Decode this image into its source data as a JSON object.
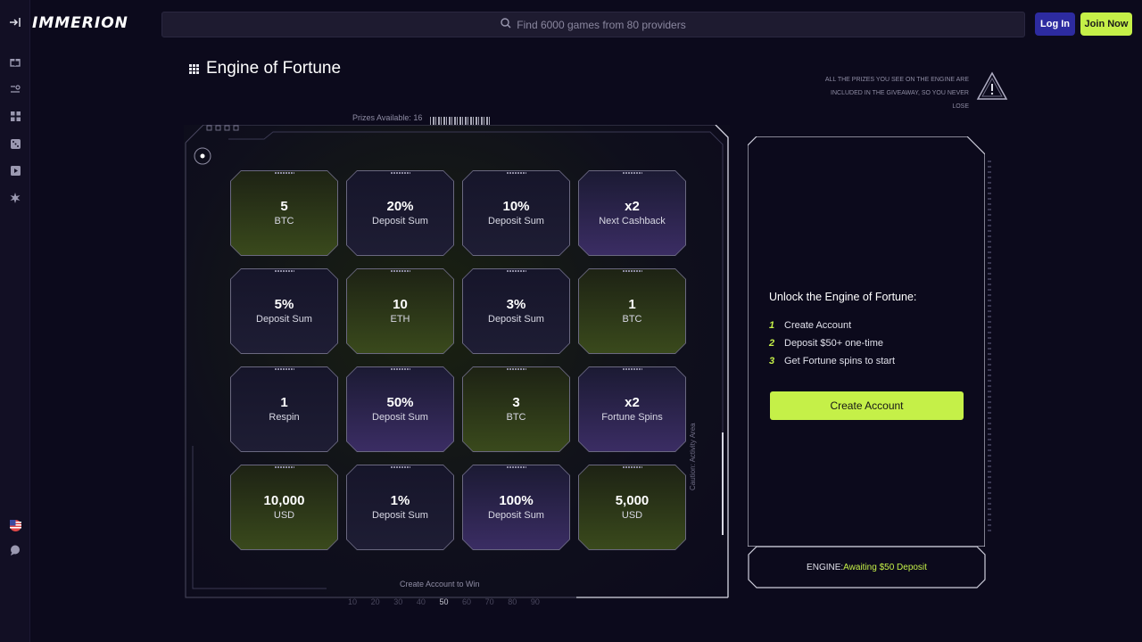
{
  "app": {
    "logo": "IMMERION",
    "collapse_icon": "collapse-arrow-icon"
  },
  "search": {
    "placeholder": "Find 6000 games from 80 providers"
  },
  "auth": {
    "login_label": "Log In",
    "join_label": "Join Now"
  },
  "colors": {
    "accent": "#c5f048",
    "login": "#2d2ba0",
    "bg": "#0c0a1c"
  },
  "sidebar": {
    "items": [
      "gift-icon",
      "search-list-icon",
      "grid-icon",
      "dice-icon",
      "play-icon",
      "star-burst-icon"
    ],
    "bottom": [
      "us-flag-icon",
      "chat-icon"
    ]
  },
  "page": {
    "title": "Engine of Fortune",
    "disclaimer": "ALL THE PRIZES YOU SEE ON THE ENGINE ARE INCLUDED IN THE GIVEAWAY, SO YOU NEVER LOSE"
  },
  "engine": {
    "prizes_available": "Prizes Available: 16",
    "cta": "Create Account to Win",
    "caution": "Caution: Activity Area",
    "scale": [
      "10",
      "20",
      "30",
      "40",
      "50",
      "60",
      "70",
      "80",
      "90"
    ],
    "scale_active": "50",
    "prizes": [
      {
        "value": "5",
        "label": "BTC",
        "style": "green"
      },
      {
        "value": "20%",
        "label": "Deposit Sum",
        "style": "dark"
      },
      {
        "value": "10%",
        "label": "Deposit Sum",
        "style": "dark"
      },
      {
        "value": "x2",
        "label": "Next Cashback",
        "style": "purple"
      },
      {
        "value": "5%",
        "label": "Deposit Sum",
        "style": "dark"
      },
      {
        "value": "10",
        "label": "ETH",
        "style": "green"
      },
      {
        "value": "3%",
        "label": "Deposit Sum",
        "style": "dark"
      },
      {
        "value": "1",
        "label": "BTC",
        "style": "green"
      },
      {
        "value": "1",
        "label": "Respin",
        "style": "dark"
      },
      {
        "value": "50%",
        "label": "Deposit Sum",
        "style": "purple"
      },
      {
        "value": "3",
        "label": "BTC",
        "style": "green"
      },
      {
        "value": "x2",
        "label": "Fortune Spins",
        "style": "purple"
      },
      {
        "value": "10,000",
        "label": "USD",
        "style": "green"
      },
      {
        "value": "1%",
        "label": "Deposit Sum",
        "style": "dark"
      },
      {
        "value": "100%",
        "label": "Deposit Sum",
        "style": "purple"
      },
      {
        "value": "5,000",
        "label": "USD",
        "style": "green"
      }
    ]
  },
  "unlock": {
    "title": "Unlock the Engine of Fortune:",
    "steps": [
      {
        "num": "1",
        "text": "Create Account"
      },
      {
        "num": "2",
        "text": "Deposit $50+ one-time"
      },
      {
        "num": "3",
        "text": "Get Fortune spins to start"
      }
    ],
    "button": "Create Account",
    "status_key": "ENGINE:",
    "status_value": "Awaiting $50 Deposit"
  }
}
